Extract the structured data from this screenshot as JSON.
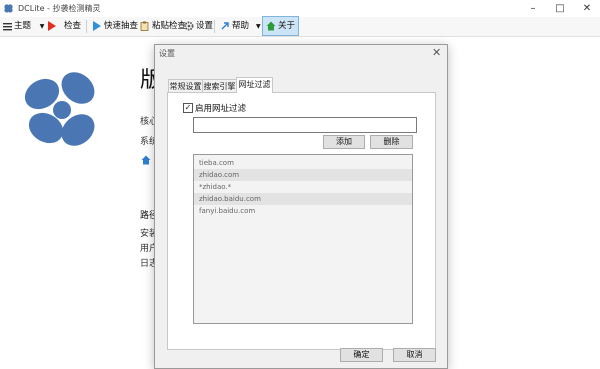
{
  "window": {
    "title": "DCLite - 抄袭检测精灵"
  },
  "toolbar": {
    "theme": "主题",
    "check": "检查",
    "quick": "快速抽查",
    "paste": "粘贴检查",
    "settings": "设置",
    "help": "帮助",
    "about": "关于"
  },
  "background": {
    "title": "版",
    "line1": "核心",
    "line2": "系统",
    "path": "路径",
    "install": "安装",
    "user": "用户",
    "log": "日志"
  },
  "dialog": {
    "title": "设置",
    "tabs": [
      "常规设置",
      "搜索引擎",
      "网址过滤"
    ],
    "enable_label": "启用网址过滤",
    "input_value": "",
    "add": "添加",
    "delete": "删除",
    "list": [
      "tieba.com",
      "zhidao.com",
      "*zhidao.*",
      "zhidao.baidu.com",
      "fanyi.baidu.com"
    ],
    "ok": "确定",
    "cancel": "取消"
  },
  "colors": {
    "accent": "#4a77b4",
    "active_bg": "#cde4f7"
  }
}
